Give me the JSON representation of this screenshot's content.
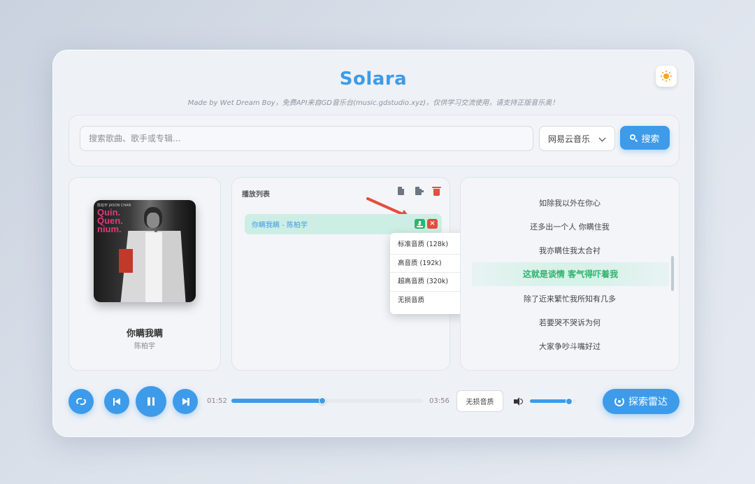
{
  "app": {
    "title": "Solara",
    "subtitle": "Made by Wet Dream Boy，免费API来自GD音乐台(music.gdstudio.xyz)，仅供学习交流使用，请支持正版音乐奥！",
    "accent_color": "#3d9be9",
    "success_color": "#2fb36f",
    "danger_color": "#e74c3c"
  },
  "theme_toggle": {
    "icon": "sun-icon"
  },
  "search": {
    "placeholder": "搜索歌曲、歌手或专辑...",
    "value": "",
    "source_selected": "网易云音乐",
    "button_label": "搜索"
  },
  "now_playing": {
    "title": "你瞒我瞒",
    "artist": "陈柏宇",
    "cover_text": "Quin.\nQuen.\nnium.",
    "cover_small_text": "陈柏宇 JASON CHAN"
  },
  "playlist": {
    "header": "播放列表",
    "items": [
      {
        "label": "你瞒我瞒 - 陈柏宇"
      }
    ],
    "remove_label": "×"
  },
  "quality_menu": {
    "options": [
      "标准音质 (128k)",
      "高音质 (192k)",
      "超高音质 (320k)",
      "无损音质"
    ]
  },
  "lyrics": {
    "lines": [
      "如除我以外在你心",
      "还多出一个人 你瞒住我",
      "我亦瞒住我太合衬",
      "这就是谈情 客气得吓着我",
      "除了近来繁忙我所知有几多",
      "若要哭不哭诉为何",
      "大家争吵斗嘴好过"
    ],
    "active_index": 3
  },
  "player": {
    "current_time": "01:52",
    "duration": "03:56",
    "progress": 0.475,
    "quality_label": "无损音质",
    "volume": 0.85,
    "radar_label": "探索雷达"
  }
}
